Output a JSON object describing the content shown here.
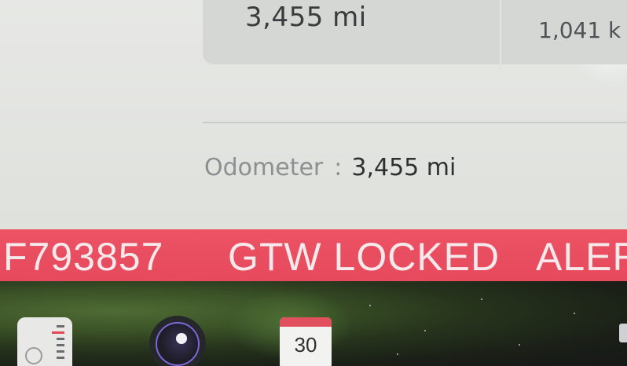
{
  "trip_card": {
    "value_a": "3,455 mi",
    "value_b": "1,041 k"
  },
  "odometer": {
    "label": "Odometer",
    "colon": ":",
    "value": "3,455 mi"
  },
  "alert_bar": {
    "code": "F793857",
    "message": "GTW LOCKED",
    "more": "ALER",
    "color": "#e84d5f"
  },
  "dock": {
    "apps": [
      {
        "name": "energy",
        "icon": "energy-gauge-icon"
      },
      {
        "name": "camera",
        "icon": "camera-icon"
      },
      {
        "name": "calendar",
        "icon": "calendar-icon",
        "day": "30"
      }
    ]
  }
}
